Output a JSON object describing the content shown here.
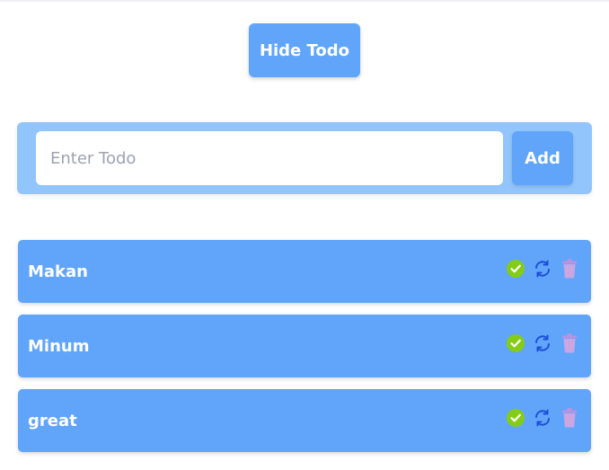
{
  "header": {
    "toggle_label": "Hide Todo"
  },
  "form": {
    "placeholder": "Enter Todo",
    "value": "",
    "add_label": "Add"
  },
  "todos": [
    {
      "text": "Makan",
      "actions": [
        "check-circle-icon",
        "refresh-icon",
        "trash-icon"
      ]
    },
    {
      "text": "Minum",
      "actions": [
        "check-circle-icon",
        "refresh-icon",
        "trash-icon"
      ]
    },
    {
      "text": "great",
      "actions": [
        "check-circle-icon",
        "refresh-icon",
        "trash-icon"
      ]
    }
  ],
  "colors": {
    "primary": "#60a5fa",
    "panel": "#93c5fd",
    "check": "#84cc16",
    "refresh": "#1d4ed8",
    "trash": "#c4a7e7"
  }
}
